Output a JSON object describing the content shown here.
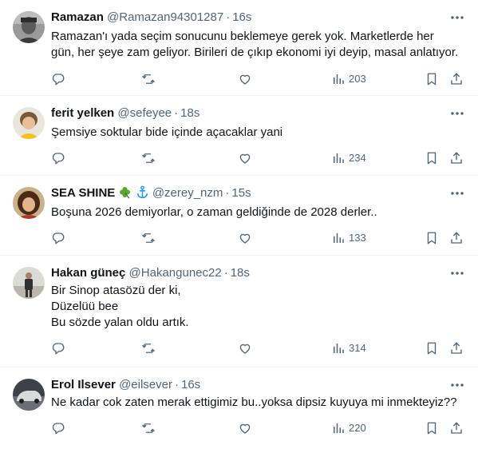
{
  "tweets": [
    {
      "name": "Ramazan",
      "handle": "@Ramazan94301287",
      "sep": "·",
      "time": "16s",
      "lines": [
        "Ramazan'ı yada seçim sonucunu beklemeye gerek yok.  Marketlerde her",
        "gün, her şeye zam geliyor. Birileri de çıkıp ekonomi iyi deyip, masal anlatıyor."
      ],
      "views": "203",
      "avatar": "avatar-portrait-bw"
    },
    {
      "name": "ferit yelken",
      "handle": "@sefeyee",
      "sep": "·",
      "time": "18s",
      "lines": [
        "Şemsiye soktular bide içinde açacaklar yani"
      ],
      "views": "234",
      "avatar": "avatar-child"
    },
    {
      "name": "SEA SHINE",
      "name_emoji": [
        "shamrock-icon",
        "anchor-icon"
      ],
      "handle": "@zerey_nzm",
      "sep": "·",
      "time": "15s",
      "lines": [
        "Boşuna 2026 demiyorlar, o zaman geldiğinde de 2028 derler.."
      ],
      "views": "133",
      "avatar": "avatar-woman"
    },
    {
      "name": "Hakan güneç",
      "handle": "@Hakangunec22",
      "sep": "·",
      "time": "18s",
      "lines": [
        "Bir Sinop atasözü der ki,",
        "Düzelüü bee",
        "Bu sözde yalan oldu artık."
      ],
      "views": "314",
      "avatar": "avatar-man-standing"
    },
    {
      "name": "Erol Ilsever",
      "handle": "@eilsever",
      "sep": "·",
      "time": "16s",
      "lines": [
        "Ne kadar cok zaten merak ettigimiz bu..yoksa dipsiz kuyuya mi inmekteyiz??"
      ],
      "views": "220",
      "avatar": "avatar-car"
    }
  ],
  "colors": {
    "text": "#0f1419",
    "secondary": "#536471",
    "divider": "#eff3f4",
    "shamrock": "#5aa832",
    "anchor": "#1d9bf0"
  }
}
